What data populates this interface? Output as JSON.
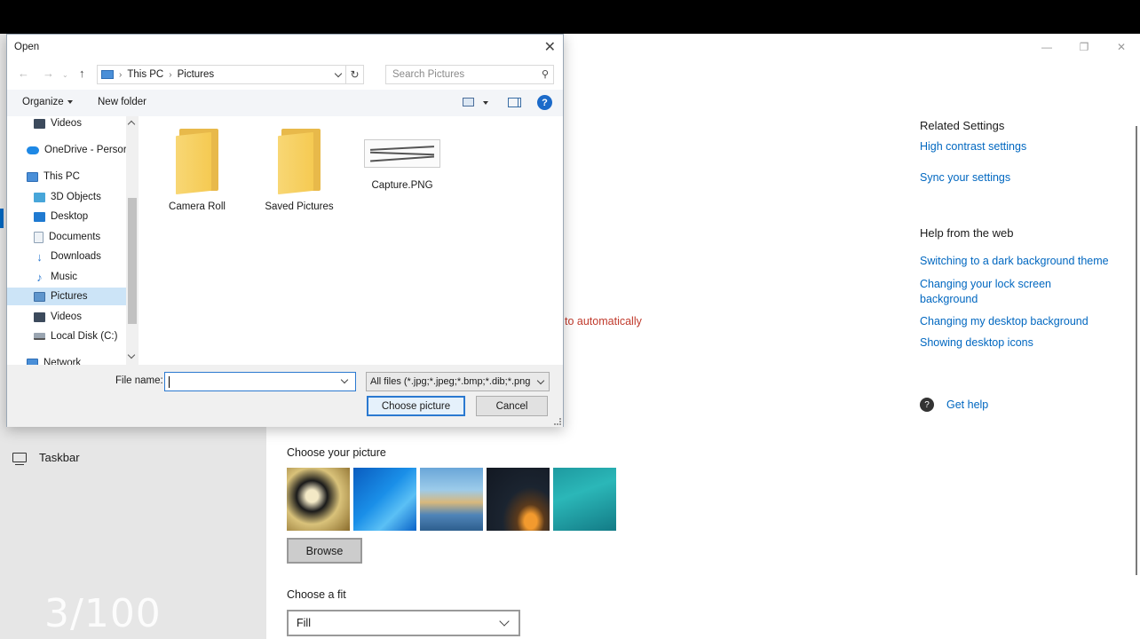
{
  "settings": {
    "taskbar_label": "Taskbar",
    "watermark": "3/100",
    "partial_text": "to automatically",
    "choose_picture_label": "Choose your picture",
    "browse_label": "Browse",
    "choose_fit_label": "Choose a fit",
    "fit_value": "Fill",
    "window_controls": {
      "minimize": "—",
      "restore": "❐",
      "close": "✕"
    },
    "related": {
      "header": "Related Settings",
      "links": [
        "High contrast settings",
        "Sync your settings"
      ]
    },
    "help_web": {
      "header": "Help from the web",
      "links": [
        "Switching to a dark background theme",
        "Changing your lock screen background",
        "Changing my desktop background",
        "Showing desktop icons"
      ]
    },
    "get_help": "Get help"
  },
  "dialog": {
    "title": "Open",
    "close": "✕",
    "address": {
      "root": "This PC",
      "folder": "Pictures"
    },
    "search_placeholder": "Search Pictures",
    "toolbar": {
      "organize": "Organize",
      "new_folder": "New folder",
      "help": "?"
    },
    "nav_items": [
      {
        "label": "Videos",
        "icon": "video-icon"
      },
      {
        "label": "OneDrive - Persor",
        "icon": "onedrive-icon"
      },
      {
        "label": "This PC",
        "icon": "pc-icon"
      },
      {
        "label": "3D Objects",
        "icon": "cube-icon"
      },
      {
        "label": "Desktop",
        "icon": "desktop-icon"
      },
      {
        "label": "Documents",
        "icon": "document-icon"
      },
      {
        "label": "Downloads",
        "icon": "download-icon"
      },
      {
        "label": "Music",
        "icon": "music-icon"
      },
      {
        "label": "Pictures",
        "icon": "pictures-icon",
        "selected": true
      },
      {
        "label": "Videos",
        "icon": "video-icon"
      },
      {
        "label": "Local Disk (C:)",
        "icon": "disk-icon"
      },
      {
        "label": "Network",
        "icon": "network-icon"
      }
    ],
    "files": [
      {
        "name": "Camera Roll",
        "type": "folder"
      },
      {
        "name": "Saved Pictures",
        "type": "folder"
      },
      {
        "name": "Capture.PNG",
        "type": "image"
      }
    ],
    "file_name_label": "File name:",
    "file_name_value": "",
    "file_filter": "All files (*.jpg;*.jpeg;*.bmp;*.dib;*.png",
    "choose_button": "Choose picture",
    "cancel_button": "Cancel"
  }
}
